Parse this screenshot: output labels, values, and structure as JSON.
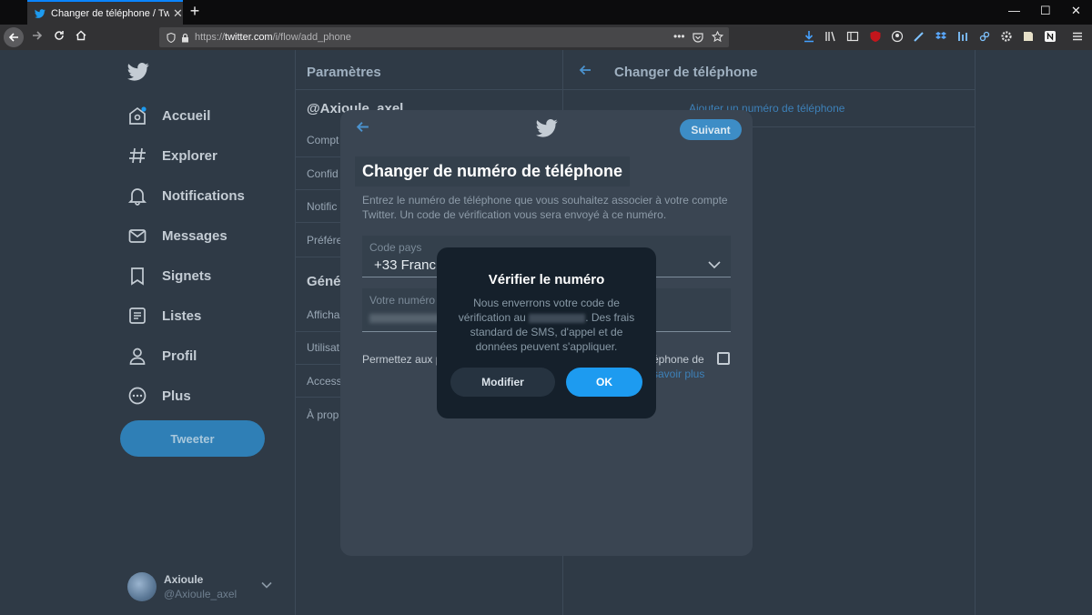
{
  "browser": {
    "tab_title": "Changer de téléphone / Twitter",
    "tab_close": "✕",
    "new_tab": "+",
    "url_prefix": "https://",
    "url_domain": "twitter.com",
    "url_path": "/i/flow/add_phone",
    "page_actions": "•••",
    "window_minimize": "—",
    "window_maximize": "☐",
    "window_close": "✕"
  },
  "sidebar": {
    "items": [
      {
        "label": "Accueil",
        "icon": "home-icon"
      },
      {
        "label": "Explorer",
        "icon": "hashtag-icon"
      },
      {
        "label": "Notifications",
        "icon": "bell-icon"
      },
      {
        "label": "Messages",
        "icon": "envelope-icon"
      },
      {
        "label": "Signets",
        "icon": "bookmark-icon"
      },
      {
        "label": "Listes",
        "icon": "list-icon"
      },
      {
        "label": "Profil",
        "icon": "person-icon"
      },
      {
        "label": "Plus",
        "icon": "more-icon"
      }
    ],
    "tweet_button": "Tweeter",
    "account": {
      "name": "Axioule",
      "handle": "@Axioule_axel"
    }
  },
  "settings": {
    "title": "Paramètres",
    "account_heading": "@Axioule_axel",
    "account_items": [
      "Compt",
      "Confid",
      "Notific",
      "Préfére"
    ],
    "general_heading": "Géné",
    "general_items": [
      "Afficha",
      "Utilisat",
      "Access",
      "À prop"
    ]
  },
  "detail": {
    "title": "Changer de téléphone",
    "link": "Ajouter un numéro de téléphone"
  },
  "modal": {
    "next_button": "Suivant",
    "title": "Changer de numéro de téléphone",
    "description": "Entrez le numéro de téléphone que vous souhaitez associer à votre compte Twitter. Un code de vérification vous sera envoyé à ce numéro.",
    "country_label": "Code pays",
    "country_value": "+33 Franc",
    "phone_label": "Votre numéro",
    "permission_left": "Permettez aux p vous trouver et",
    "permission_right": "éphone de",
    "permission_link": "savoir plus"
  },
  "confirm": {
    "title": "Vérifier le numéro",
    "text_before": "Nous enverrons votre code de vérification au",
    "text_after": ". Des frais standard de SMS, d'appel et de données peuvent s'appliquer.",
    "modify_button": "Modifier",
    "ok_button": "OK"
  },
  "colors": {
    "accent": "#1d9bf0",
    "app_background": "#2f3a46",
    "dialog_background": "#15202b"
  }
}
